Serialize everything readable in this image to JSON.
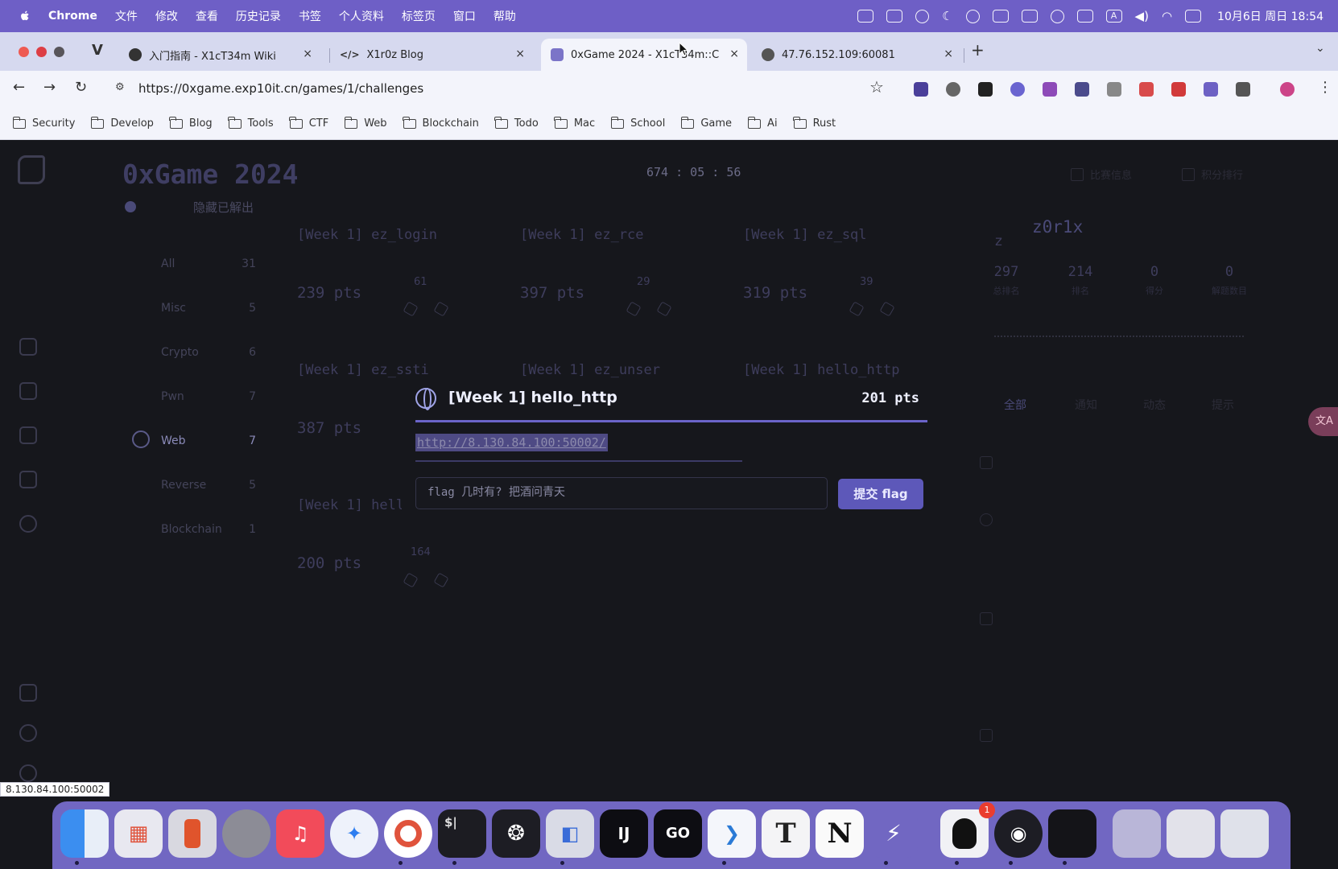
{
  "menubar": {
    "app_name": "Chrome",
    "items": [
      "文件",
      "修改",
      "查看",
      "历史记录",
      "书签",
      "个人资料",
      "标签页",
      "窗口",
      "帮助"
    ],
    "clock": "10月6日 周日 18:54",
    "input_method": "A"
  },
  "tabs": [
    {
      "title": "入门指南 - X1cT34m Wiki",
      "close": "×"
    },
    {
      "title": "X1r0z Blog",
      "close": "×"
    },
    {
      "title": "0xGame 2024 - X1cT34m::C",
      "close": "×"
    },
    {
      "title": "47.76.152.109:60081",
      "close": "×"
    }
  ],
  "tabstrip": {
    "new_tab": "+",
    "tab_menu": "⌄"
  },
  "toolbar": {
    "back": "←",
    "forward": "→",
    "reload": "↻",
    "site_info": "⚙",
    "url": "https://0xgame.exp10it.cn/games/1/challenges",
    "bookmark_star": "☆"
  },
  "bookmarks": [
    "Security",
    "Develop",
    "Blog",
    "Tools",
    "CTF",
    "Web",
    "Blockchain",
    "Todo",
    "Mac",
    "School",
    "Game",
    "Ai",
    "Rust"
  ],
  "page": {
    "site_title": "0xGame 2024",
    "timer": "674 : 05 : 56",
    "top_nav": [
      "比赛信息",
      "积分排行"
    ],
    "hide_solved": "隐藏已解出",
    "categories": [
      {
        "name": "All",
        "count": "31"
      },
      {
        "name": "Misc",
        "count": "5"
      },
      {
        "name": "Crypto",
        "count": "6"
      },
      {
        "name": "Pwn",
        "count": "7"
      },
      {
        "name": "Web",
        "count": "7"
      },
      {
        "name": "Reverse",
        "count": "5"
      },
      {
        "name": "Blockchain",
        "count": "1"
      }
    ],
    "challenges": [
      {
        "title": "[Week 1] ez_login",
        "pts": "239 pts",
        "solves": "61"
      },
      {
        "title": "[Week 1] ez_rce",
        "pts": "397 pts",
        "solves": "29"
      },
      {
        "title": "[Week 1] ez_sql",
        "pts": "319 pts",
        "solves": "39"
      },
      {
        "title": "[Week 1] ez_ssti",
        "pts": "387 pts",
        "solves": ""
      },
      {
        "title": "[Week 1] ez_unser",
        "pts": "",
        "solves": ""
      },
      {
        "title": "[Week 1] hello_http",
        "pts": "",
        "solves": ""
      },
      {
        "title": "[Week 1] hellc",
        "pts": "200 pts",
        "solves": "164"
      }
    ],
    "user": {
      "initial": "z",
      "name": "z0r1x",
      "stats": [
        {
          "value": "297",
          "label": "总排名"
        },
        {
          "value": "214",
          "label": "排名"
        },
        {
          "value": "0",
          "label": "得分"
        },
        {
          "value": "0",
          "label": "解题数目"
        }
      ]
    },
    "feed_filters": [
      "全部",
      "通知",
      "动态",
      "提示"
    ],
    "side_bubble": "文A"
  },
  "modal": {
    "title": "[Week 1] hello_http",
    "pts": "201 pts",
    "link": "http://8.130.84.100:50002/",
    "flag_placeholder": "flag 几时有? 把酒问青天",
    "submit": "提交 flag"
  },
  "status_tip": "8.130.84.100:50002",
  "dock": {
    "apps": [
      "Finder",
      "Launchpad",
      "iPhone Mirroring",
      "System Settings",
      "Music",
      "Safari",
      "Chrome",
      "Terminal",
      "ChatGPT",
      "Screen Sharing",
      "IntelliJ IDEA",
      "GoLand",
      "VS Code",
      "Typora",
      "Notion",
      "Reeder",
      "QQ",
      "OBS",
      "Console",
      "Downloads",
      "Screenshots",
      "Trash"
    ],
    "labels": {
      "terminal": "$|",
      "intellij": "IJ",
      "goland": "GO",
      "typora": "T",
      "notion": "N",
      "reeder": "⚡"
    },
    "qq_badge": "1"
  },
  "colors": {
    "menubar": "#6e5fc6",
    "accent": "#5d58b9",
    "dock": "#7167c2"
  }
}
